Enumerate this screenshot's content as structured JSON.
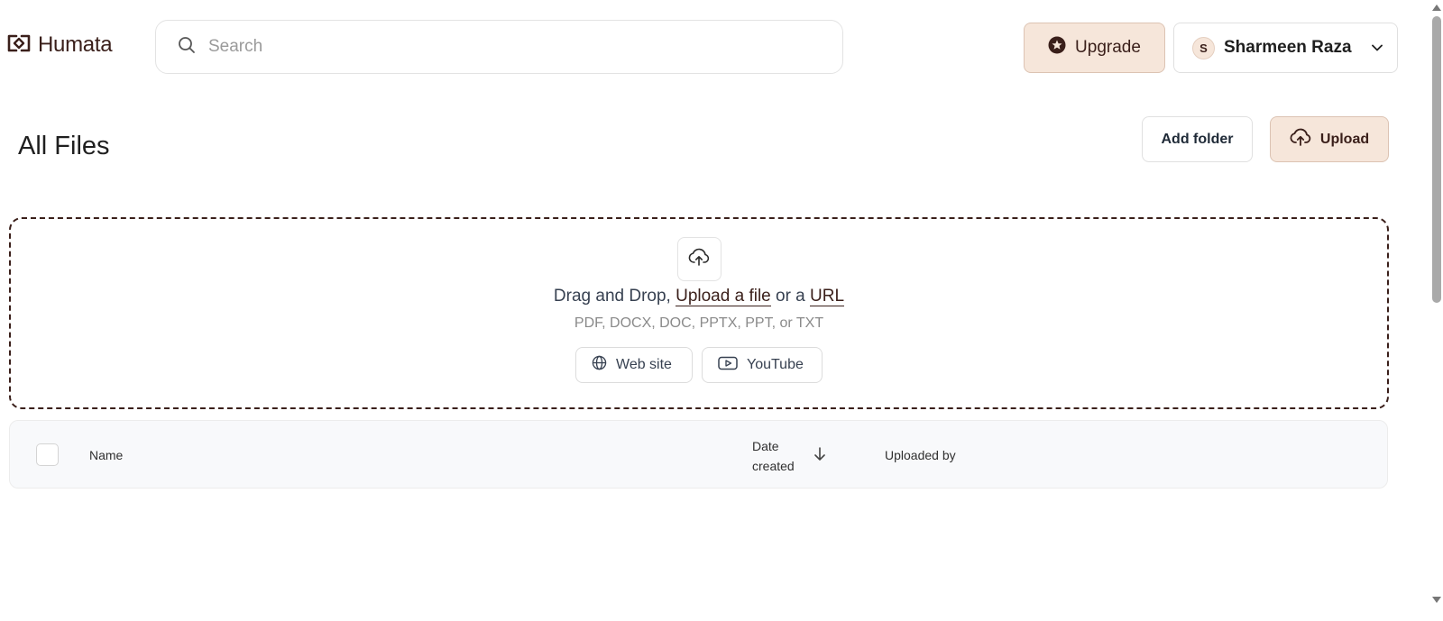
{
  "header": {
    "logo_text": "Humata",
    "search_placeholder": "Search",
    "upgrade_label": "Upgrade",
    "user_initial": "S",
    "user_name": "Sharmeen Raza"
  },
  "toolbar": {
    "title": "All Files",
    "add_folder_label": "Add folder",
    "upload_label": "Upload"
  },
  "dropzone": {
    "prefix": "Drag and Drop, ",
    "upload_link": "Upload a file",
    "middle": " or a ",
    "url_link": "URL",
    "formats": "PDF, DOCX, DOC, PPTX, PPT, or TXT",
    "website_label": "Web site",
    "youtube_label": "YouTube"
  },
  "table": {
    "columns": {
      "name": "Name",
      "date_created": "Date created",
      "uploaded_by": "Uploaded by"
    },
    "sort": "date_created descending"
  },
  "colors": {
    "brand": "#3a1f1a",
    "accent_bg": "#f6e6da",
    "accent_border": "#dcc3b3"
  },
  "icons": [
    "humata-logo-icon",
    "search-icon",
    "star-badge-icon",
    "chevron-down-icon",
    "cloud-upload-icon",
    "globe-icon",
    "youtube-icon",
    "arrow-down-icon"
  ]
}
